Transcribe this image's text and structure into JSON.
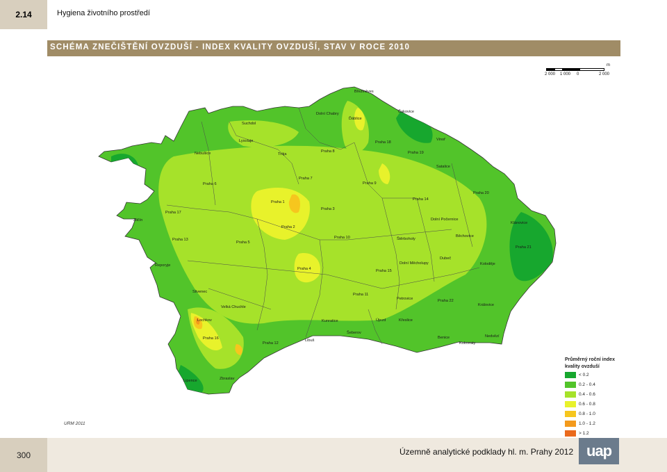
{
  "header": {
    "section_number": "2.14",
    "section_title": "Hygiena životního prostředí"
  },
  "map_title": "SCHÉMA ZNEČIŠTĚNÍ OVZDUŠÍ - INDEX KVALITY OVZDUŠÍ, STAV V ROCE 2010",
  "scale": {
    "unit": "m",
    "labels": [
      "2 000",
      "1 000",
      "0",
      "2 000"
    ]
  },
  "districts": [
    "Březiněves",
    "Dolní Chabry",
    "Ďáblice",
    "Čakovice",
    "Suchdol",
    "Lysolaje",
    "Praha 18",
    "Vinoř",
    "Nebušice",
    "Trója",
    "Praha 8",
    "Praha 19",
    "Satalice",
    "Praha 7",
    "Praha 9",
    "Praha 6",
    "Praha 20",
    "Praha 1",
    "Praha 14",
    "Praha 3",
    "Praha 17",
    "Zličín",
    "Dolní Počernice",
    "Klánovice",
    "Praha 2",
    "Praha 13",
    "Praha 10",
    "Štěrboholy",
    "Běchovice",
    "Praha 5",
    "Praha 21",
    "Dubeč",
    "Řeporyje",
    "Praha 4",
    "Dolní Měcholupy",
    "Koloděje",
    "Praha 15",
    "Slivenec",
    "Praha 11",
    "Petrovice",
    "Praha 22",
    "Velká Chuchle",
    "Královice",
    "Lochkov",
    "Kunratice",
    "Újezd",
    "Křeslice",
    "Praha 16",
    "Šeberov",
    "Praha 12",
    "Libuš",
    "Benice",
    "Nedvězí",
    "Kolovraty",
    "Zbraslav",
    "Lipence"
  ],
  "legend": {
    "title_line1": "Průměrný roční index",
    "title_line2": "kvality ovzduší",
    "items": [
      {
        "label": "< 0.2",
        "color": "#17a72e"
      },
      {
        "label": "0.2 - 0.4",
        "color": "#52c42a"
      },
      {
        "label": "0.4 - 0.6",
        "color": "#a6e22a"
      },
      {
        "label": "0.6 - 0.8",
        "color": "#e8f22b"
      },
      {
        "label": "0.8 - 1.0",
        "color": "#f6c61e"
      },
      {
        "label": "1.0 - 1.2",
        "color": "#f39a1c"
      },
      {
        "label": "> 1.2",
        "color": "#ea6a1c"
      }
    ]
  },
  "source": "URM 2011",
  "footer": {
    "page_number": "300",
    "publication": "Územně analytické podklady hl. m. Prahy 2012",
    "logo_text": "uap"
  }
}
